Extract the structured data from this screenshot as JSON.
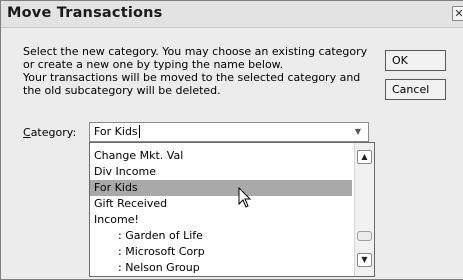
{
  "dialog": {
    "title": "Move Transactions",
    "close_glyph": "✕"
  },
  "description": {
    "line1": "Select the new category. You may choose an existing category",
    "line2": "or create a new one by typing the name below.",
    "line3": "Your transactions will be moved to the selected category and",
    "line4": "the old subcategory will be deleted."
  },
  "buttons": {
    "ok_label": "OK",
    "cancel_label": "Cancel"
  },
  "category": {
    "label_accel": "C",
    "label_rest": "ategory:",
    "value": "For Kids"
  },
  "dropdown": {
    "items": [
      {
        "label": "Change Mkt. Val",
        "selected": false,
        "indent": false
      },
      {
        "label": "Div Income",
        "selected": false,
        "indent": false
      },
      {
        "label": "For Kids",
        "selected": true,
        "indent": false
      },
      {
        "label": "Gift Received",
        "selected": false,
        "indent": false
      },
      {
        "label": "Income!",
        "selected": false,
        "indent": false
      },
      {
        "label": ": Garden of Life",
        "selected": false,
        "indent": true
      },
      {
        "label": ": Microsoft Corp",
        "selected": false,
        "indent": true
      },
      {
        "label": ": Nelson Group",
        "selected": false,
        "indent": true
      }
    ]
  },
  "icons": {
    "combo_arrow": "chevron-down-icon",
    "scroll_up": "scroll-up-arrow-icon",
    "scroll_down": "scroll-down-arrow-icon",
    "pointer": "mouse-pointer-icon"
  },
  "colors": {
    "selection": "#a9a9a9",
    "dialog_bg": "#ececec"
  }
}
